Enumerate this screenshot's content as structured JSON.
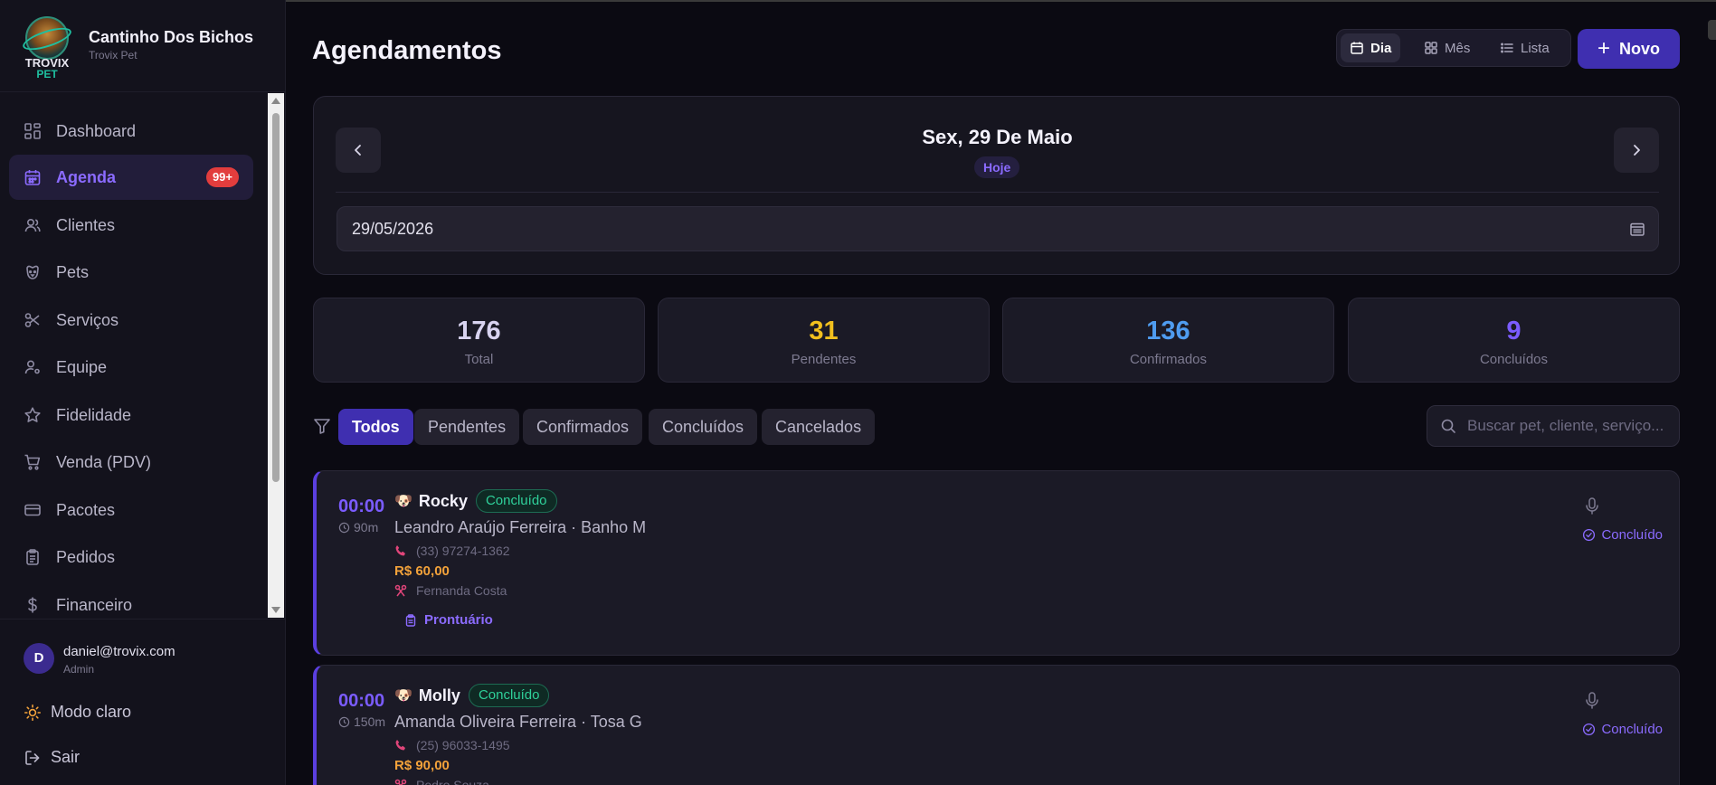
{
  "brand": {
    "logo_word_top": "TROVIX",
    "logo_word_bottom": "PET",
    "name": "Cantinho Dos Bichos",
    "subtitle": "Trovix Pet"
  },
  "sidebar": {
    "items": [
      {
        "label": "Dashboard",
        "icon": "grid-icon"
      },
      {
        "label": "Agenda",
        "icon": "calendar-icon",
        "badge": "99+",
        "active": true
      },
      {
        "label": "Clientes",
        "icon": "users-icon"
      },
      {
        "label": "Pets",
        "icon": "paw-icon"
      },
      {
        "label": "Serviços",
        "icon": "scissors-icon"
      },
      {
        "label": "Equipe",
        "icon": "user-cog-icon"
      },
      {
        "label": "Fidelidade",
        "icon": "star-icon"
      },
      {
        "label": "Venda (PDV)",
        "icon": "cart-icon"
      },
      {
        "label": "Pacotes",
        "icon": "card-icon"
      },
      {
        "label": "Pedidos",
        "icon": "clipboard-icon"
      },
      {
        "label": "Financeiro",
        "icon": "dollar-icon"
      }
    ]
  },
  "user": {
    "initial": "D",
    "email": "daniel@trovix.com",
    "role": "Admin"
  },
  "footer": {
    "theme_label": "Modo claro",
    "logout_label": "Sair"
  },
  "header": {
    "title": "Agendamentos",
    "views": [
      "Dia",
      "Mês",
      "Lista"
    ],
    "active_view": "Dia",
    "new_label": "Novo"
  },
  "date_nav": {
    "title": "Sex, 29 De Maio",
    "today_label": "Hoje",
    "date_value": "29/05/2026"
  },
  "stats": [
    {
      "value": "176",
      "label": "Total",
      "color": "#d8d3f0"
    },
    {
      "value": "31",
      "label": "Pendentes",
      "color": "#f2c01e"
    },
    {
      "value": "136",
      "label": "Confirmados",
      "color": "#4f9cf0"
    },
    {
      "value": "9",
      "label": "Concluídos",
      "color": "#7b5cff"
    }
  ],
  "filters": [
    "Todos",
    "Pendentes",
    "Confirmados",
    "Concluídos",
    "Cancelados"
  ],
  "active_filter": "Todos",
  "search": {
    "placeholder": "Buscar pet, cliente, serviço..."
  },
  "appointments": [
    {
      "time": "00:00",
      "duration": "90m",
      "pet_emoji": "🐶",
      "pet": "Rocky",
      "status": "Concluído",
      "client_service": "Leandro Araújo Ferreira · Banho M",
      "phone": "(33) 97274-1362",
      "price": "R$ 60,00",
      "staff": "Fernanda Costa",
      "record_label": "Prontuário",
      "state_label": "Concluído"
    },
    {
      "time": "00:00",
      "duration": "150m",
      "pet_emoji": "🐶",
      "pet": "Molly",
      "status": "Concluído",
      "client_service": "Amanda Oliveira Ferreira · Tosa G",
      "phone": "(25) 96033-1495",
      "price": "R$ 90,00",
      "staff": "Pedro Souza",
      "state_label": "Concluído"
    }
  ]
}
